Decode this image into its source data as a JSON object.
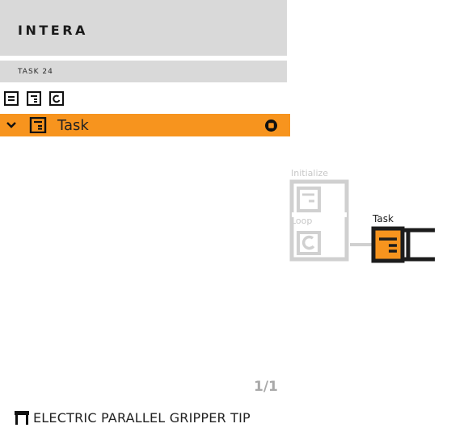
{
  "header": {
    "brand": "INTERA"
  },
  "subbar": {
    "label": "TASK 24"
  },
  "toolbar": {
    "icons": [
      "initialize-block-icon",
      "task-block-icon",
      "loop-block-icon"
    ]
  },
  "task_row": {
    "label": "Task",
    "icons": [
      "chevron-down-icon",
      "task-block-icon",
      "stop-icon"
    ],
    "background": "#f7941e"
  },
  "diagram": {
    "initialize_label": "Initialize",
    "loop_label": "Loop",
    "task_label": "Task",
    "colors": {
      "inactive": "#d0d0d0",
      "active": "#f7941e",
      "outline": "#1c1c1c"
    }
  },
  "pager": {
    "text": "1/1"
  },
  "footer": {
    "icon": "gripper-icon",
    "label": "ELECTRIC PARALLEL GRIPPER TIP"
  }
}
